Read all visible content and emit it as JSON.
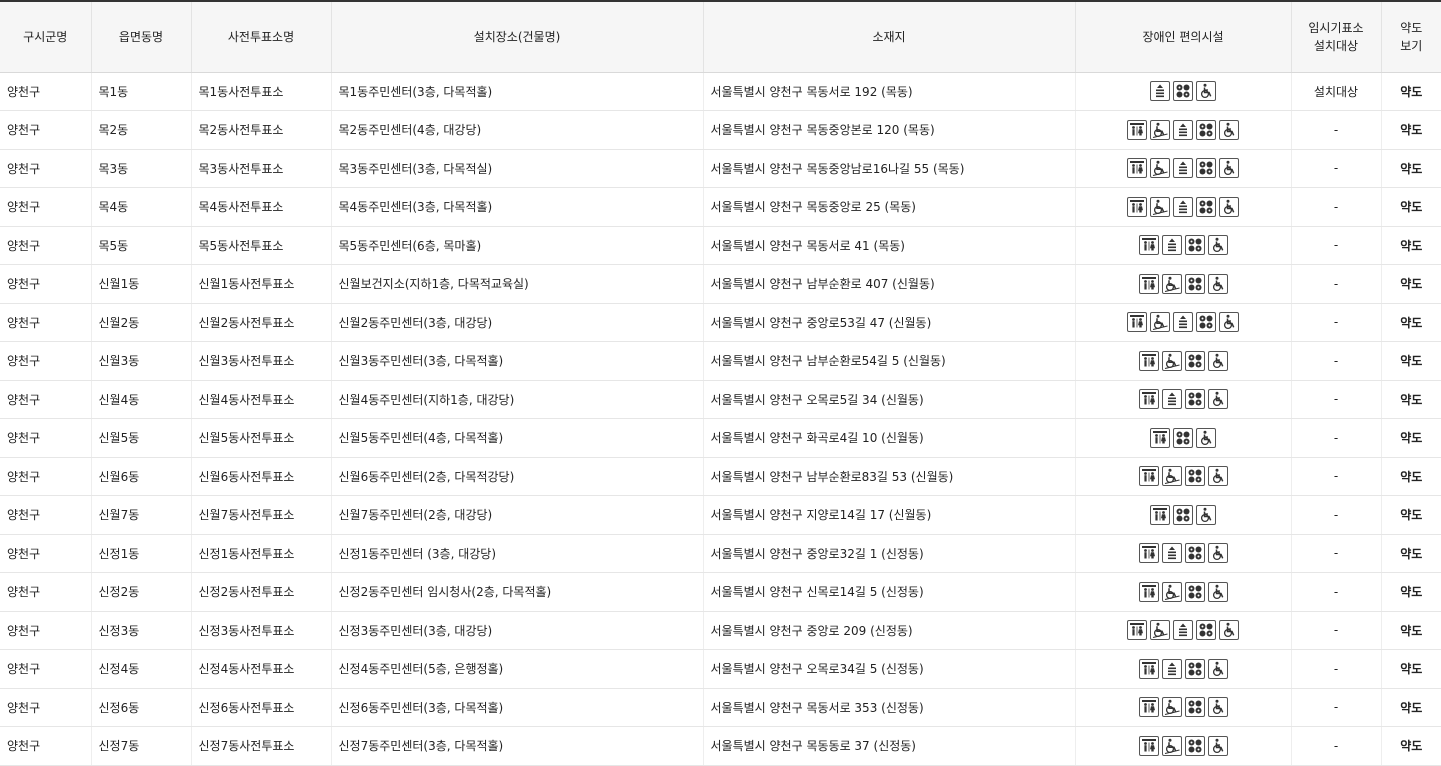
{
  "headers": [
    "구시군명",
    "읍면동명",
    "사전투표소명",
    "설치장소(건물명)",
    "소재지",
    "장애인 편의시설",
    "임시기표소\n설치대상",
    "약도\n보기"
  ],
  "map_label": "약도",
  "rows": [
    {
      "gu": "양천구",
      "dong": "목1동",
      "station": "목1동사전투표소",
      "place": "목1동주민센터(3층, 다목적홀)",
      "addr": "서울특별시 양천구 목동서로 192 (목동)",
      "icons": [
        "elevator-icon",
        "braille-block-icon",
        "wheelchair-icon"
      ],
      "temp": "설치대상"
    },
    {
      "gu": "양천구",
      "dong": "목2동",
      "station": "목2동사전투표소",
      "place": "목2동주민센터(4층, 대강당)",
      "addr": "서울특별시 양천구 목동중앙본로 120 (목동)",
      "icons": [
        "accessible-restroom-icon",
        "wheelchair-ramp-icon",
        "elevator-icon",
        "braille-block-icon",
        "wheelchair-icon"
      ],
      "temp": "-"
    },
    {
      "gu": "양천구",
      "dong": "목3동",
      "station": "목3동사전투표소",
      "place": "목3동주민센터(3층, 다목적실)",
      "addr": "서울특별시 양천구 목동중앙남로16나길 55 (목동)",
      "icons": [
        "accessible-restroom-icon",
        "wheelchair-ramp-icon",
        "elevator-icon",
        "braille-block-icon",
        "wheelchair-icon"
      ],
      "temp": "-"
    },
    {
      "gu": "양천구",
      "dong": "목4동",
      "station": "목4동사전투표소",
      "place": "목4동주민센터(3층, 다목적홀)",
      "addr": "서울특별시 양천구 목동중앙로 25 (목동)",
      "icons": [
        "accessible-restroom-icon",
        "wheelchair-ramp-icon",
        "elevator-icon",
        "braille-block-icon",
        "wheelchair-icon"
      ],
      "temp": "-"
    },
    {
      "gu": "양천구",
      "dong": "목5동",
      "station": "목5동사전투표소",
      "place": "목5동주민센터(6층, 목마홀)",
      "addr": "서울특별시 양천구 목동서로 41 (목동)",
      "icons": [
        "accessible-restroom-icon",
        "elevator-icon",
        "braille-block-icon",
        "wheelchair-icon"
      ],
      "temp": "-"
    },
    {
      "gu": "양천구",
      "dong": "신월1동",
      "station": "신월1동사전투표소",
      "place": "신월보건지소(지하1층, 다목적교육실)",
      "addr": "서울특별시 양천구 남부순환로 407 (신월동)",
      "icons": [
        "accessible-restroom-icon",
        "wheelchair-ramp-icon",
        "braille-block-icon",
        "wheelchair-icon"
      ],
      "temp": "-"
    },
    {
      "gu": "양천구",
      "dong": "신월2동",
      "station": "신월2동사전투표소",
      "place": "신월2동주민센터(3층, 대강당)",
      "addr": "서울특별시 양천구 중앙로53길 47 (신월동)",
      "icons": [
        "accessible-restroom-icon",
        "wheelchair-ramp-icon",
        "elevator-icon",
        "braille-block-icon",
        "wheelchair-icon"
      ],
      "temp": "-"
    },
    {
      "gu": "양천구",
      "dong": "신월3동",
      "station": "신월3동사전투표소",
      "place": "신월3동주민센터(3층, 다목적홀)",
      "addr": "서울특별시 양천구 남부순환로54길 5 (신월동)",
      "icons": [
        "accessible-restroom-icon",
        "wheelchair-ramp-icon",
        "braille-block-icon",
        "wheelchair-icon"
      ],
      "temp": "-"
    },
    {
      "gu": "양천구",
      "dong": "신월4동",
      "station": "신월4동사전투표소",
      "place": "신월4동주민센터(지하1층, 대강당)",
      "addr": "서울특별시 양천구 오목로5길 34 (신월동)",
      "icons": [
        "accessible-restroom-icon",
        "elevator-icon",
        "braille-block-icon",
        "wheelchair-icon"
      ],
      "temp": "-"
    },
    {
      "gu": "양천구",
      "dong": "신월5동",
      "station": "신월5동사전투표소",
      "place": "신월5동주민센터(4층, 다목적홀)",
      "addr": "서울특별시 양천구 화곡로4길 10 (신월동)",
      "icons": [
        "accessible-restroom-icon",
        "braille-block-icon",
        "wheelchair-icon"
      ],
      "temp": "-"
    },
    {
      "gu": "양천구",
      "dong": "신월6동",
      "station": "신월6동사전투표소",
      "place": "신월6동주민센터(2층, 다목적강당)",
      "addr": "서울특별시 양천구 남부순환로83길 53 (신월동)",
      "icons": [
        "accessible-restroom-icon",
        "wheelchair-ramp-icon",
        "braille-block-icon",
        "wheelchair-icon"
      ],
      "temp": "-"
    },
    {
      "gu": "양천구",
      "dong": "신월7동",
      "station": "신월7동사전투표소",
      "place": "신월7동주민센터(2층, 대강당)",
      "addr": "서울특별시 양천구 지양로14길 17 (신월동)",
      "icons": [
        "accessible-restroom-icon",
        "braille-block-icon",
        "wheelchair-icon"
      ],
      "temp": "-"
    },
    {
      "gu": "양천구",
      "dong": "신정1동",
      "station": "신정1동사전투표소",
      "place": "신정1동주민센터 (3층, 대강당)",
      "addr": "서울특별시 양천구 중앙로32길 1 (신정동)",
      "icons": [
        "accessible-restroom-icon",
        "elevator-icon",
        "braille-block-icon",
        "wheelchair-icon"
      ],
      "temp": "-"
    },
    {
      "gu": "양천구",
      "dong": "신정2동",
      "station": "신정2동사전투표소",
      "place": "신정2동주민센터 임시청사(2층, 다목적홀)",
      "addr": "서울특별시 양천구 신목로14길 5 (신정동)",
      "icons": [
        "accessible-restroom-icon",
        "wheelchair-ramp-icon",
        "braille-block-icon",
        "wheelchair-icon"
      ],
      "temp": "-"
    },
    {
      "gu": "양천구",
      "dong": "신정3동",
      "station": "신정3동사전투표소",
      "place": "신정3동주민센터(3층, 대강당)",
      "addr": "서울특별시 양천구 중앙로 209 (신정동)",
      "icons": [
        "accessible-restroom-icon",
        "wheelchair-ramp-icon",
        "elevator-icon",
        "braille-block-icon",
        "wheelchair-icon"
      ],
      "temp": "-"
    },
    {
      "gu": "양천구",
      "dong": "신정4동",
      "station": "신정4동사전투표소",
      "place": "신정4동주민센터(5층, 은행정홀)",
      "addr": "서울특별시 양천구 오목로34길 5 (신정동)",
      "icons": [
        "accessible-restroom-icon",
        "elevator-icon",
        "braille-block-icon",
        "wheelchair-icon"
      ],
      "temp": "-"
    },
    {
      "gu": "양천구",
      "dong": "신정6동",
      "station": "신정6동사전투표소",
      "place": "신정6동주민센터(3층, 다목적홀)",
      "addr": "서울특별시 양천구 목동서로 353 (신정동)",
      "icons": [
        "accessible-restroom-icon",
        "wheelchair-ramp-icon",
        "braille-block-icon",
        "wheelchair-icon"
      ],
      "temp": "-"
    },
    {
      "gu": "양천구",
      "dong": "신정7동",
      "station": "신정7동사전투표소",
      "place": "신정7동주민센터(3층, 다목적홀)",
      "addr": "서울특별시 양천구 목동동로 37 (신정동)",
      "icons": [
        "accessible-restroom-icon",
        "wheelchair-ramp-icon",
        "braille-block-icon",
        "wheelchair-icon"
      ],
      "temp": "-"
    }
  ]
}
